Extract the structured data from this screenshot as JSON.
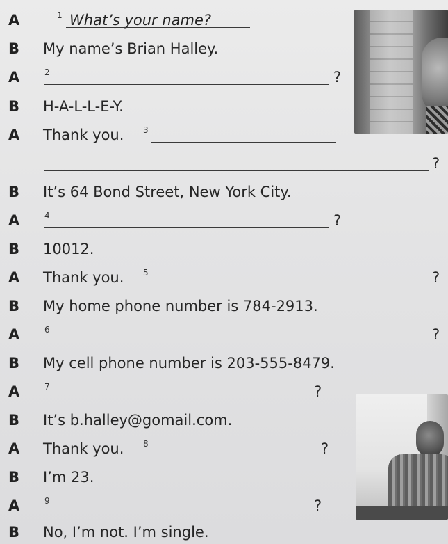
{
  "dialogue": [
    {
      "speaker": "A",
      "num": "1",
      "answer": "What’s your name?"
    },
    {
      "speaker": "B",
      "text": "My name’s Brian Halley."
    },
    {
      "speaker": "A",
      "num": "2",
      "q": "?"
    },
    {
      "speaker": "B",
      "text": "H-A-L-L-E-Y."
    },
    {
      "speaker": "A",
      "text": "Thank you.",
      "num": "3"
    },
    {
      "q": "?"
    },
    {
      "speaker": "B",
      "text": "It’s 64 Bond Street, New York City."
    },
    {
      "speaker": "A",
      "num": "4",
      "q": "?"
    },
    {
      "speaker": "B",
      "text": "10012."
    },
    {
      "speaker": "A",
      "text": "Thank you.",
      "num": "5",
      "q": "?"
    },
    {
      "speaker": "B",
      "text": "My home phone number is 784-2913."
    },
    {
      "speaker": "A",
      "num": "6",
      "q": "?"
    },
    {
      "speaker": "B",
      "text": "My cell phone number is 203-555-8479."
    },
    {
      "speaker": "A",
      "num": "7",
      "q": "?"
    },
    {
      "speaker": "B",
      "text": "It’s b.halley@gomail.com."
    },
    {
      "speaker": "A",
      "text": "Thank you.",
      "num": "8",
      "q": "?"
    },
    {
      "speaker": "B",
      "text": "I’m 23."
    },
    {
      "speaker": "A",
      "num": "9",
      "q": "?"
    },
    {
      "speaker": "B",
      "text": "No, I’m not. I’m single."
    }
  ]
}
